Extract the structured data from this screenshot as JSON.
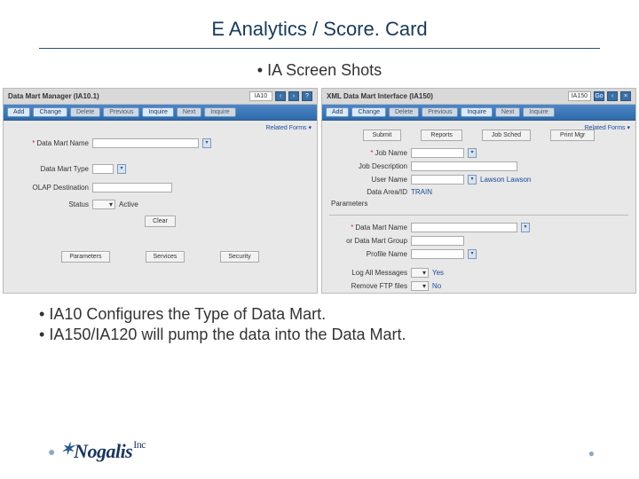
{
  "title": "E Analytics /  Score. Card",
  "subheading": "IA Screen Shots",
  "left_app": {
    "window_title": "Data Mart Manager (IA10.1)",
    "id_field": "IA10",
    "toolbar": [
      "Add",
      "Change",
      "Delete",
      "Previous",
      "Inquire",
      "Next",
      "Inquire"
    ],
    "related": "Related Forms ▾",
    "fields": {
      "data_mart_name": "Data Mart Name",
      "data_mart_type": "Data Mart Type",
      "olap_destination": "OLAP Destination",
      "status": "Status",
      "status_value": "Active"
    },
    "center_button": "Clear",
    "buttons": [
      "Parameters",
      "Services",
      "Security"
    ]
  },
  "right_app": {
    "window_title": "XML Data Mart Interface (IA150)",
    "id_field": "IA150",
    "toolbar": [
      "Add",
      "Change",
      "Delete",
      "Previous",
      "Inquire",
      "Next",
      "Inquire"
    ],
    "related": "Related Forms ▾",
    "tabs": [
      "Submit",
      "Reports",
      "Job Sched",
      "Print Mgr"
    ],
    "fields": {
      "job_name": "Job Name",
      "job_desc": "Job Description",
      "user_name": "User Name",
      "user_value": "Lawson Lawson",
      "data_area": "Data Area/ID",
      "data_area_value": "TRAIN",
      "section": "Parameters",
      "data_mart_name": "Data Mart Name",
      "or_group": "or Data Mart Group",
      "profile": "Profile Name",
      "log_all": "Log All Messages",
      "log_val": "Yes",
      "remove": "Remove FTP files",
      "remove_val": "No"
    }
  },
  "bullets": [
    "IA10 Configures the Type of Data Mart.",
    "IA150/IA120 will pump the data into the Data Mart."
  ],
  "logo": {
    "name": "Nogalis",
    "suffix": "Inc"
  }
}
